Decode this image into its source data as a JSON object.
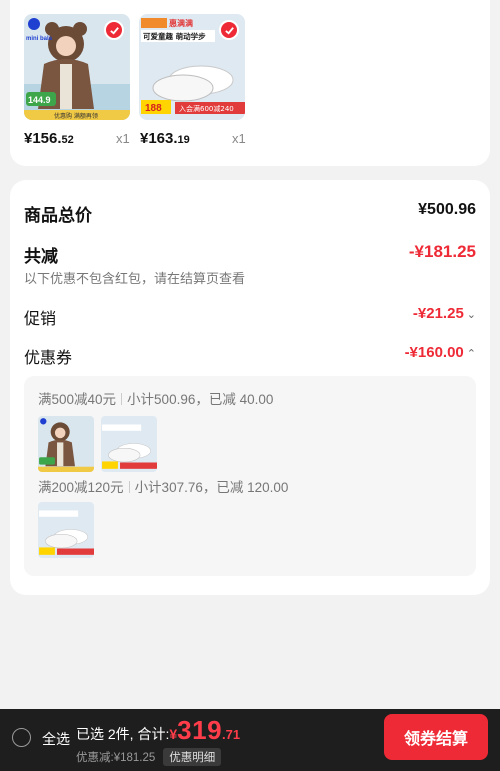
{
  "products": [
    {
      "price_int": "¥156.",
      "price_dec": "52",
      "qty": "x1",
      "image_text": {
        "brand": "mini bala",
        "price": "144.9",
        "strip": "优惠购 满额再领"
      }
    },
    {
      "price_int": "¥163.",
      "price_dec": "19",
      "qty": "x1",
      "image_text": {
        "tag": "惠满满",
        "headline": "可爱童趣 萌动学步",
        "price": "188",
        "strip": "入会满600减240"
      }
    }
  ],
  "summary": {
    "total_label": "商品总价",
    "total_value": "¥500.96",
    "discount_label": "共减",
    "discount_value": "-¥181.25",
    "discount_note": "以下优惠不包含红包，请在结算页查看",
    "promo_label": "促销",
    "promo_value": "-¥21.25",
    "coupon_label": "优惠券",
    "coupon_value": "-¥160.00",
    "coupons": [
      {
        "rule": "满500减40元",
        "subtotal": "小计500.96，已减 40.00"
      },
      {
        "rule": "满200减120元",
        "subtotal": "小计307.76，已减 120.00"
      }
    ]
  },
  "bottom": {
    "select_all": "全选",
    "selected_text": "已选 2件, 合计:",
    "currency": "¥",
    "total_big": "319",
    "total_dec": ".71",
    "saved_text": "优惠减:¥181.25",
    "detail_button": "优惠明细",
    "checkout_button": "领券结算"
  },
  "colors": {
    "accent": "#ee2a36",
    "bar": "#1e1e1e"
  },
  "icons": {
    "check": "check-icon",
    "chevron_down": "chevron-down-icon",
    "chevron_up": "chevron-up-icon",
    "radio": "radio-icon"
  }
}
